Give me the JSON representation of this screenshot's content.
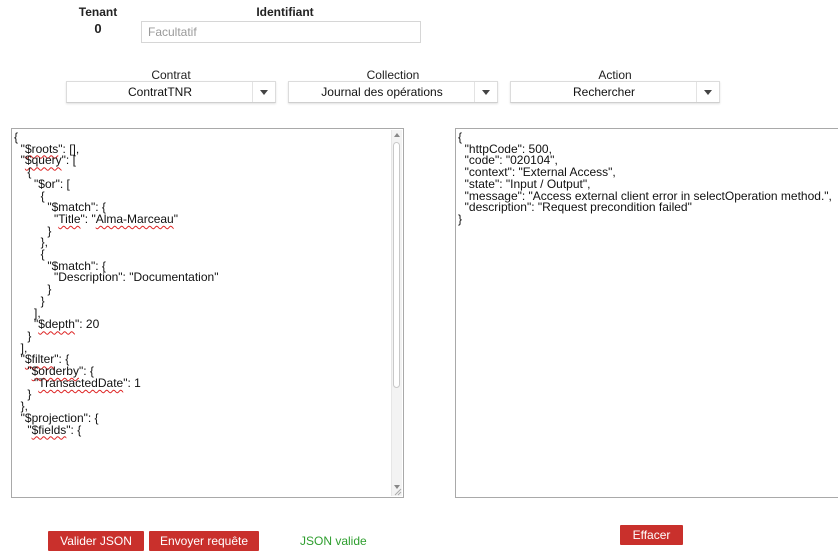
{
  "header": {
    "tenant_label": "Tenant",
    "tenant_value": "0",
    "identifiant_label": "Identifiant",
    "identifiant_placeholder": "Facultatif"
  },
  "selectors": {
    "contrat": {
      "label": "Contrat",
      "value": "ContratTNR"
    },
    "collection": {
      "label": "Collection",
      "value": "Journal des opérations"
    },
    "action": {
      "label": "Action",
      "value": "Rechercher"
    }
  },
  "query_editor": {
    "lines": [
      "{",
      "  \"$roots\": [],",
      "  \"$query\": [",
      "    {",
      "      \"$or\": [",
      "        {",
      "          \"$match\": {",
      "            \"Title\": \"Alma-Marceau\"",
      "          }",
      "        },",
      "        {",
      "          \"$match\": {",
      "            \"Description\": \"Documentation\"",
      "          }",
      "        }",
      "      ],",
      "      \"$depth\": 20",
      "    }",
      "  ],",
      "  \"$filter\": {",
      "    \"$orderby\": {",
      "      \"TransactedDate\": 1",
      "    }",
      "  },",
      "  \"$projection\": {",
      "    \"$fields\": {"
    ]
  },
  "response_editor": {
    "lines": [
      "{",
      "  \"httpCode\": 500,",
      "  \"code\": \"020104\",",
      "  \"context\": \"External Access\",",
      "  \"state\": \"Input / Output\",",
      "  \"message\": \"Access external client error in selectOperation method.\",",
      "  \"description\": \"Request precondition failed\"",
      "}"
    ]
  },
  "buttons": {
    "validate": "Valider JSON",
    "send": "Envoyer requête",
    "clear": "Effacer"
  },
  "status": {
    "json_status": "JSON valide"
  },
  "colors": {
    "button_bg": "#c9302c",
    "status_ok": "#2e9e2e",
    "spell_underline": "#d22"
  },
  "icons": {
    "select_caret": "chevron-down-icon",
    "scroll_up": "arrow-up-icon",
    "scroll_down": "arrow-down-icon"
  }
}
